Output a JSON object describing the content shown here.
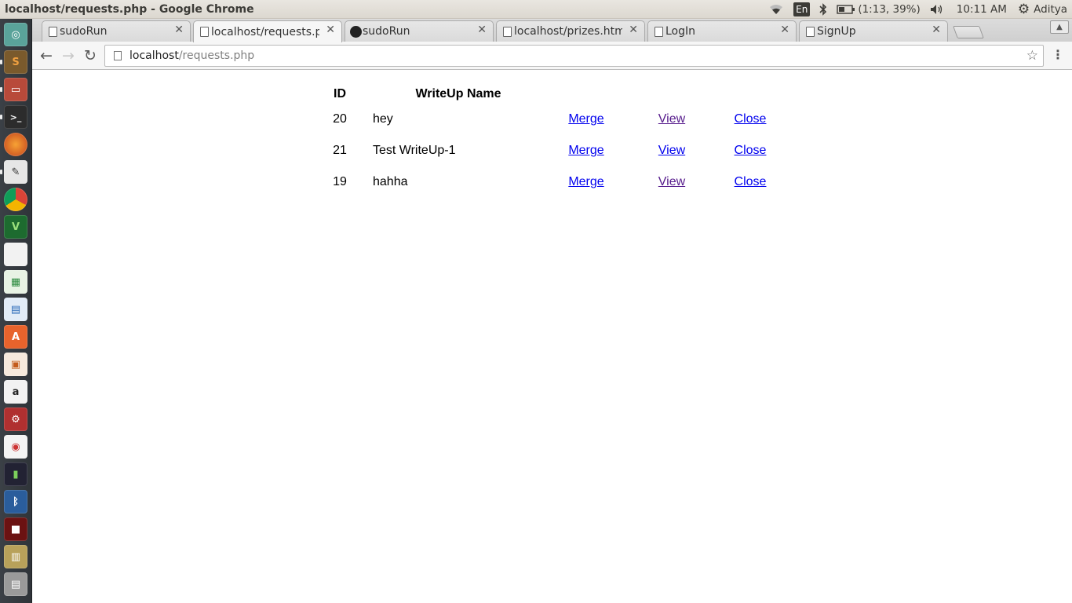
{
  "os_panel": {
    "window_title": "localhost/requests.php - Google Chrome",
    "keyboard": "En",
    "battery": "(1:13, 39%)",
    "clock": "10:11 AM",
    "user": "Aditya"
  },
  "launcher": {
    "items": [
      "dash-icon",
      "sublime-text-icon",
      "files-icon",
      "terminal-icon",
      "firefox-icon",
      "text-editor-icon",
      "chrome-icon",
      "vim-icon",
      "document-icon",
      "spreadsheet-icon",
      "writer-icon",
      "software-center-icon",
      "impress-icon",
      "amazon-icon",
      "system-settings-icon",
      "recorder-icon",
      "battery-app-icon",
      "bluetooth-icon",
      "media-icon",
      "archive-icon",
      "trash-icon"
    ]
  },
  "tabs": [
    {
      "label": "sudoRun",
      "icon": "page-icon"
    },
    {
      "label": "localhost/requests.php",
      "icon": "page-icon"
    },
    {
      "label": "sudoRun",
      "icon": "github-icon"
    },
    {
      "label": "localhost/prizes.html",
      "icon": "page-icon"
    },
    {
      "label": "LogIn",
      "icon": "page-icon"
    },
    {
      "label": "SignUp",
      "icon": "page-icon"
    }
  ],
  "address_bar": {
    "host": "localhost",
    "path": "/requests.php"
  },
  "table": {
    "headers": {
      "id": "ID",
      "name": "WriteUp Name"
    },
    "rows": [
      {
        "id": "20",
        "name": "hey",
        "merge": "Merge",
        "view": "View",
        "close": "Close"
      },
      {
        "id": "21",
        "name": "Test WriteUp-1",
        "merge": "Merge",
        "view": "View",
        "close": "Close"
      },
      {
        "id": "19",
        "name": "hahha",
        "merge": "Merge",
        "view": "View",
        "close": "Close"
      }
    ]
  }
}
